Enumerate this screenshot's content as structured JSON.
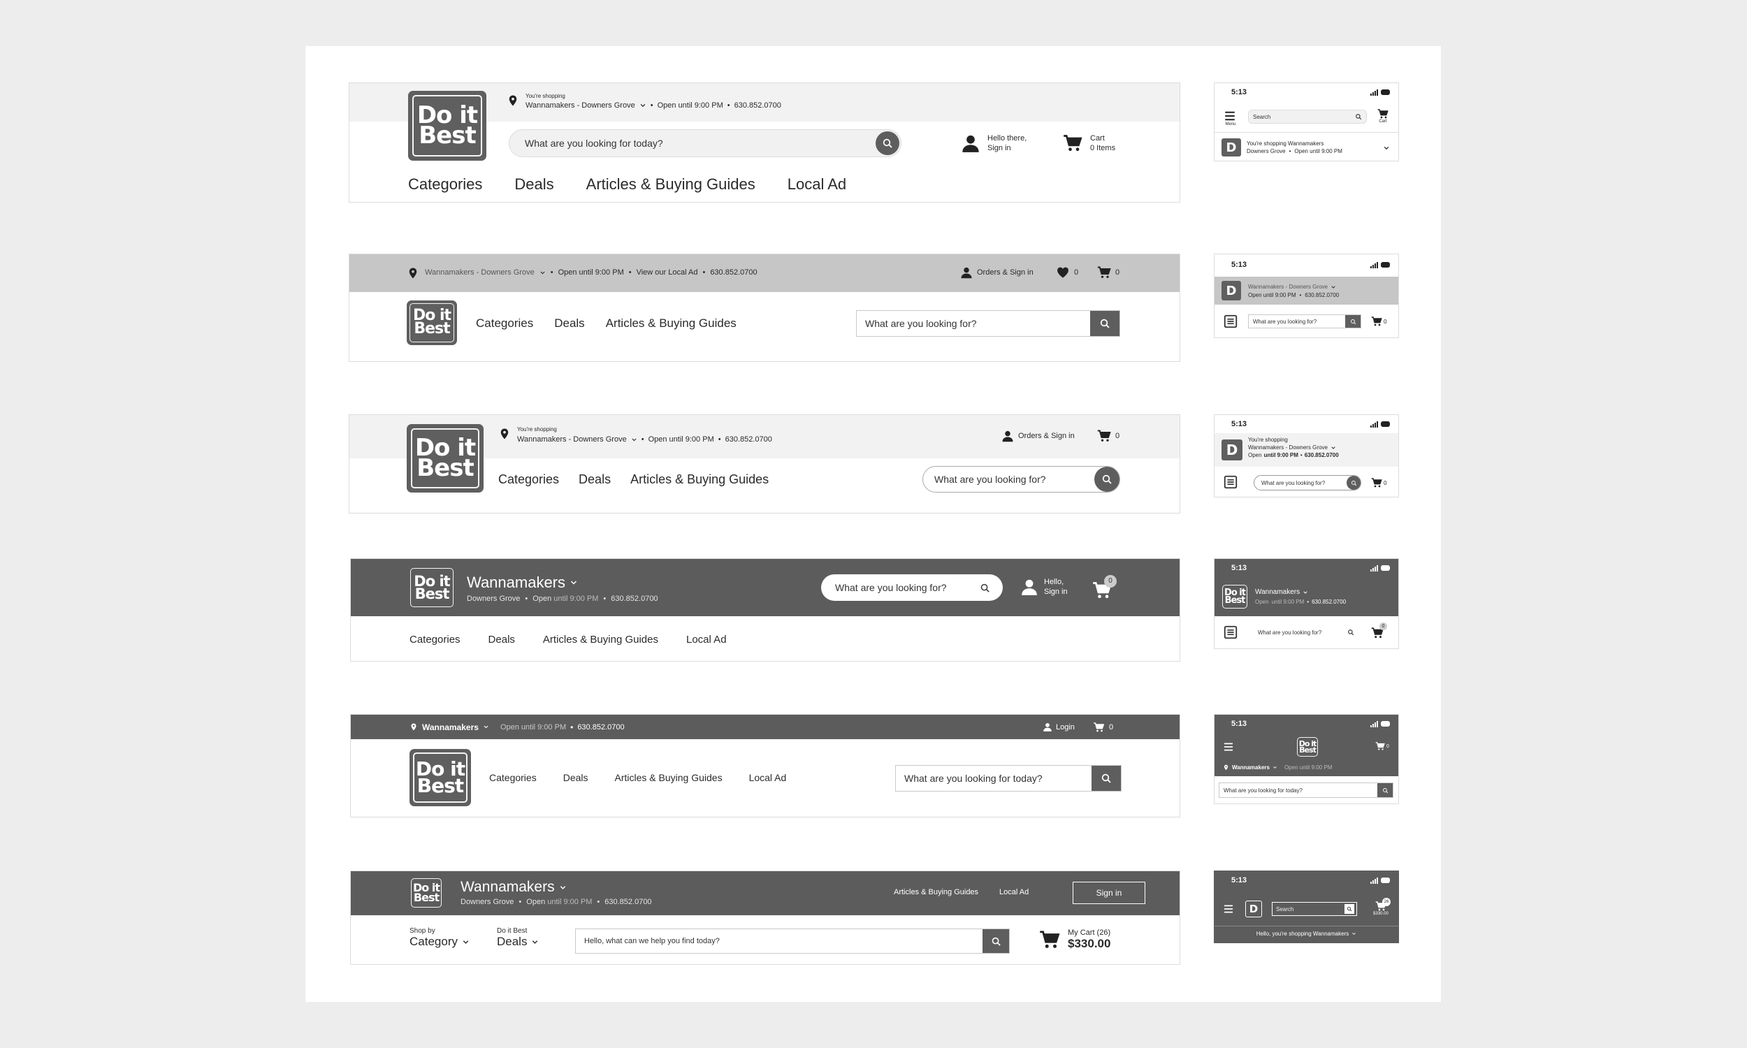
{
  "v1": {
    "shopping_label": "You're shopping",
    "store": "Wannamakers - Downers Grove",
    "hours": "Open until 9:00 PM",
    "phone": "630.852.0700",
    "search_placeholder": "What are you looking for today?",
    "greeting": "Hello there,",
    "signin": "Sign in",
    "cart_label": "Cart",
    "cart_items": "0 Items",
    "nav": [
      "Categories",
      "Deals",
      "Articles & Buying Guides",
      "Local Ad"
    ],
    "mobile": {
      "time": "5:13",
      "battery": "76",
      "menu_label": "Menu",
      "search_placeholder": "Search",
      "cart_label": "Cart",
      "shopping_line": "You're shopping Wannamakers",
      "store_line": "Downers Grove",
      "hours": "Open until 9:00 PM"
    }
  },
  "v2": {
    "store": "Wannamakers - Downers Grove",
    "hours": "Open until 9:00 PM",
    "local_ad": "View our Local Ad",
    "phone": "630.852.0700",
    "orders_signin": "Orders & Sign in",
    "wishlist_count": "0",
    "cart_count": "0",
    "nav": [
      "Categories",
      "Deals",
      "Articles & Buying Guides"
    ],
    "search_placeholder": "What are you looking for?",
    "mobile": {
      "time": "5:13",
      "battery": "76",
      "store": "Wannamakers - Downers Grove",
      "hours": "Open until 9:00 PM",
      "phone": "630.852.0700",
      "search_placeholder": "What are you looking for?",
      "cart_count": "0"
    }
  },
  "v3": {
    "shopping_label": "You're shopping",
    "store": "Wannamakers - Downers Grove",
    "hours": "Open until 9:00 PM",
    "phone": "630.852.0700",
    "orders_signin": "Orders & Sign in",
    "cart_count": "0",
    "nav": [
      "Categories",
      "Deals",
      "Articles & Buying Guides"
    ],
    "search_placeholder": "What are you looking for?",
    "mobile": {
      "time": "5:13",
      "battery": "76",
      "shopping_label": "You're shopping",
      "store": "Wannamakers - Downers Grove",
      "hours_prefix": "Open",
      "hours_rest": "until 9:00 PM",
      "phone": "630.852.0700",
      "search_placeholder": "What are you looking for?",
      "cart_count": "0"
    }
  },
  "v4": {
    "store": "Wannamakers",
    "location": "Downers Grove",
    "hours_prefix": "Open",
    "hours_rest": "until 9:00 PM",
    "phone": "630.852.0700",
    "search_placeholder": "What are you looking for?",
    "hello": "Hello,",
    "signin": "Sign in",
    "cart_count": "0",
    "nav": [
      "Categories",
      "Deals",
      "Articles & Buying Guides",
      "Local Ad"
    ],
    "mobile": {
      "time": "5:13",
      "battery": "76",
      "store": "Wannamakers",
      "hours_prefix": "Open",
      "hours_rest": "until 9:00 PM",
      "phone": "630.852.0700",
      "search_placeholder": "What are you looking for?",
      "cart_count": "0"
    }
  },
  "v5": {
    "store": "Wannamakers",
    "hours": "Open until 9:00 PM",
    "phone": "630.852.0700",
    "login": "Login",
    "cart_count": "0",
    "nav": [
      "Categories",
      "Deals",
      "Articles & Buying Guides",
      "Local Ad"
    ],
    "search_placeholder": "What are you looking for today?",
    "mobile": {
      "time": "5:13",
      "battery": "76",
      "cart_count": "0",
      "store": "Wannamakers",
      "hours": "Open until 9:00 PM",
      "search_placeholder": "What are you looking for today?"
    }
  },
  "v6": {
    "store": "Wannamakers",
    "location": "Downers Grove",
    "hours_prefix": "Open",
    "hours_rest": "until 9:00 PM",
    "phone": "630.852.0700",
    "articles": "Articles & Buying Guides",
    "local_ad": "Local Ad",
    "signin": "Sign in",
    "shop_by": "Shop by",
    "category": "Category",
    "do_it_best": "Do it Best",
    "deals": "Deals",
    "search_placeholder": "Hello, what can we help you find today?",
    "my_cart": "My Cart (26)",
    "cart_total": "$330.00",
    "mobile": {
      "time": "5:13",
      "battery": "76",
      "search_placeholder": "Search",
      "cart_total": "$330.00",
      "cart_badge": "26",
      "greeting": "Hello, you're shopping Wannamakers"
    }
  },
  "logo": {
    "line1": "Do it",
    "line2": "Best",
    "mono": "D"
  },
  "icons": [
    "pin-icon",
    "chevron-down-icon",
    "search-icon",
    "user-icon",
    "cart-icon",
    "heart-icon",
    "menu-icon"
  ]
}
